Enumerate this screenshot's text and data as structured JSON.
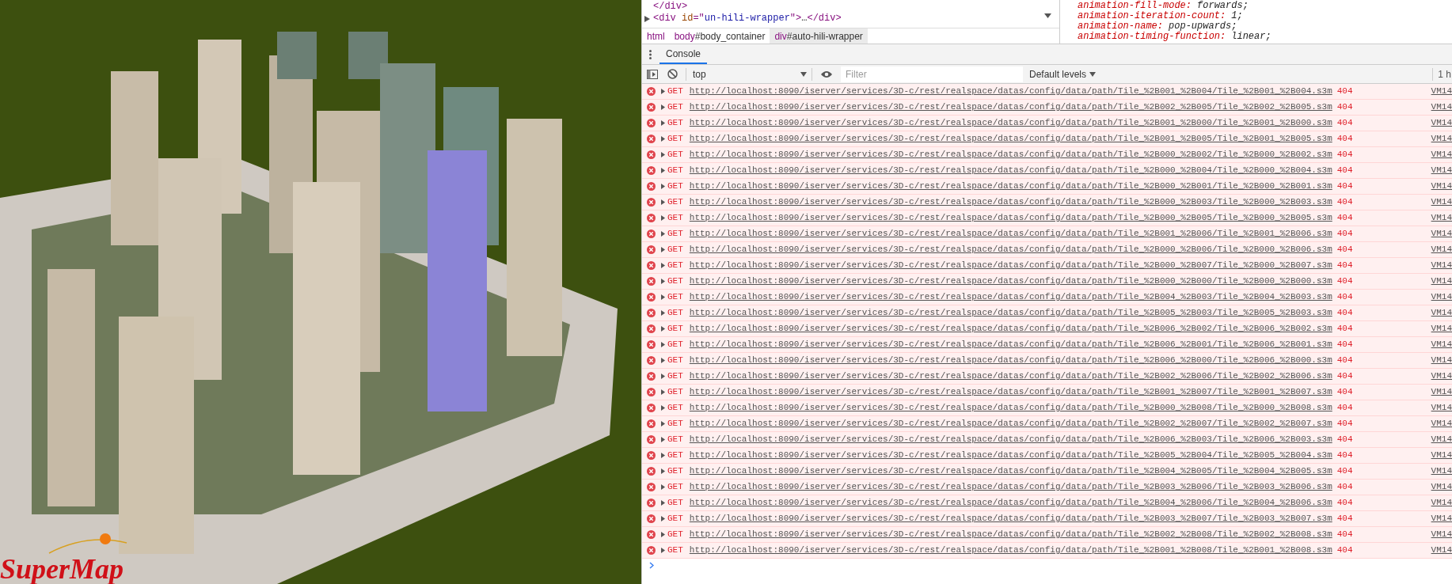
{
  "scene": {
    "logo": {
      "text": "SuperMap"
    }
  },
  "devtools": {
    "elements": {
      "lines": [
        {
          "expandable": false,
          "tokens": [
            {
              "kind": "tag",
              "text": "</div>"
            }
          ]
        },
        {
          "expandable": true,
          "tokens": [
            {
              "kind": "tag",
              "text": "<div "
            },
            {
              "kind": "attr",
              "text": "id"
            },
            {
              "kind": "tag",
              "text": "=\""
            },
            {
              "kind": "value",
              "text": "un-hili-wrapper"
            },
            {
              "kind": "tag",
              "text": "\">"
            },
            {
              "kind": "plain",
              "text": "…"
            },
            {
              "kind": "tag",
              "text": "</div>"
            }
          ]
        }
      ]
    },
    "styles": {
      "lines": [
        {
          "property": "animation-fill-mode:",
          "value": "forwards;"
        },
        {
          "property": "animation-iteration-count:",
          "value": "1;"
        },
        {
          "property": "animation-name:",
          "value": "pop-upwards;"
        },
        {
          "property": "animation-timing-function:",
          "value": "linear;"
        }
      ]
    },
    "breadcrumbs": [
      {
        "tag": "html",
        "selected": false
      },
      {
        "tag": "body",
        "id": "#body_container",
        "selected": false
      },
      {
        "tag": "div",
        "id": "#auto-hili-wrapper",
        "selected": true
      }
    ],
    "drawer_tabs": [
      {
        "label": "Console",
        "selected": true
      }
    ],
    "toolbar": {
      "context": "top",
      "filter_placeholder": "Filter",
      "levels": "Default levels",
      "time_cut": "1 h"
    },
    "messages": [
      {
        "kind": "error",
        "method": "GET",
        "url": "http://localhost:8090/iserver/services/3D-c/rest/realspace/datas/config/data/path/Tile_%2B001_%2B004/Tile_%2B001_%2B004.s3m",
        "status": "404",
        "source": "VM14"
      },
      {
        "kind": "error",
        "method": "GET",
        "url": "http://localhost:8090/iserver/services/3D-c/rest/realspace/datas/config/data/path/Tile_%2B002_%2B005/Tile_%2B002_%2B005.s3m",
        "status": "404",
        "source": "VM14"
      },
      {
        "kind": "error",
        "method": "GET",
        "url": "http://localhost:8090/iserver/services/3D-c/rest/realspace/datas/config/data/path/Tile_%2B001_%2B000/Tile_%2B001_%2B000.s3m",
        "status": "404",
        "source": "VM14"
      },
      {
        "kind": "error",
        "method": "GET",
        "url": "http://localhost:8090/iserver/services/3D-c/rest/realspace/datas/config/data/path/Tile_%2B001_%2B005/Tile_%2B001_%2B005.s3m",
        "status": "404",
        "source": "VM14"
      },
      {
        "kind": "error",
        "method": "GET",
        "url": "http://localhost:8090/iserver/services/3D-c/rest/realspace/datas/config/data/path/Tile_%2B000_%2B002/Tile_%2B000_%2B002.s3m",
        "status": "404",
        "source": "VM14"
      },
      {
        "kind": "error",
        "method": "GET",
        "url": "http://localhost:8090/iserver/services/3D-c/rest/realspace/datas/config/data/path/Tile_%2B000_%2B004/Tile_%2B000_%2B004.s3m",
        "status": "404",
        "source": "VM14"
      },
      {
        "kind": "error",
        "method": "GET",
        "url": "http://localhost:8090/iserver/services/3D-c/rest/realspace/datas/config/data/path/Tile_%2B000_%2B001/Tile_%2B000_%2B001.s3m",
        "status": "404",
        "source": "VM14"
      },
      {
        "kind": "error",
        "method": "GET",
        "url": "http://localhost:8090/iserver/services/3D-c/rest/realspace/datas/config/data/path/Tile_%2B000_%2B003/Tile_%2B000_%2B003.s3m",
        "status": "404",
        "source": "VM14"
      },
      {
        "kind": "error",
        "method": "GET",
        "url": "http://localhost:8090/iserver/services/3D-c/rest/realspace/datas/config/data/path/Tile_%2B000_%2B005/Tile_%2B000_%2B005.s3m",
        "status": "404",
        "source": "VM14"
      },
      {
        "kind": "error",
        "method": "GET",
        "url": "http://localhost:8090/iserver/services/3D-c/rest/realspace/datas/config/data/path/Tile_%2B001_%2B006/Tile_%2B001_%2B006.s3m",
        "status": "404",
        "source": "VM14"
      },
      {
        "kind": "error",
        "method": "GET",
        "url": "http://localhost:8090/iserver/services/3D-c/rest/realspace/datas/config/data/path/Tile_%2B000_%2B006/Tile_%2B000_%2B006.s3m",
        "status": "404",
        "source": "VM14"
      },
      {
        "kind": "error",
        "method": "GET",
        "url": "http://localhost:8090/iserver/services/3D-c/rest/realspace/datas/config/data/path/Tile_%2B000_%2B007/Tile_%2B000_%2B007.s3m",
        "status": "404",
        "source": "VM14"
      },
      {
        "kind": "error",
        "method": "GET",
        "url": "http://localhost:8090/iserver/services/3D-c/rest/realspace/datas/config/data/path/Tile_%2B000_%2B000/Tile_%2B000_%2B000.s3m",
        "status": "404",
        "source": "VM14"
      },
      {
        "kind": "error",
        "method": "GET",
        "url": "http://localhost:8090/iserver/services/3D-c/rest/realspace/datas/config/data/path/Tile_%2B004_%2B003/Tile_%2B004_%2B003.s3m",
        "status": "404",
        "source": "VM14"
      },
      {
        "kind": "error",
        "method": "GET",
        "url": "http://localhost:8090/iserver/services/3D-c/rest/realspace/datas/config/data/path/Tile_%2B005_%2B003/Tile_%2B005_%2B003.s3m",
        "status": "404",
        "source": "VM14"
      },
      {
        "kind": "error",
        "method": "GET",
        "url": "http://localhost:8090/iserver/services/3D-c/rest/realspace/datas/config/data/path/Tile_%2B006_%2B002/Tile_%2B006_%2B002.s3m",
        "status": "404",
        "source": "VM14"
      },
      {
        "kind": "error",
        "method": "GET",
        "url": "http://localhost:8090/iserver/services/3D-c/rest/realspace/datas/config/data/path/Tile_%2B006_%2B001/Tile_%2B006_%2B001.s3m",
        "status": "404",
        "source": "VM14"
      },
      {
        "kind": "error",
        "method": "GET",
        "url": "http://localhost:8090/iserver/services/3D-c/rest/realspace/datas/config/data/path/Tile_%2B006_%2B000/Tile_%2B006_%2B000.s3m",
        "status": "404",
        "source": "VM14"
      },
      {
        "kind": "error",
        "method": "GET",
        "url": "http://localhost:8090/iserver/services/3D-c/rest/realspace/datas/config/data/path/Tile_%2B002_%2B006/Tile_%2B002_%2B006.s3m",
        "status": "404",
        "source": "VM14"
      },
      {
        "kind": "error",
        "method": "GET",
        "url": "http://localhost:8090/iserver/services/3D-c/rest/realspace/datas/config/data/path/Tile_%2B001_%2B007/Tile_%2B001_%2B007.s3m",
        "status": "404",
        "source": "VM14"
      },
      {
        "kind": "error",
        "method": "GET",
        "url": "http://localhost:8090/iserver/services/3D-c/rest/realspace/datas/config/data/path/Tile_%2B000_%2B008/Tile_%2B000_%2B008.s3m",
        "status": "404",
        "source": "VM14"
      },
      {
        "kind": "error",
        "method": "GET",
        "url": "http://localhost:8090/iserver/services/3D-c/rest/realspace/datas/config/data/path/Tile_%2B002_%2B007/Tile_%2B002_%2B007.s3m",
        "status": "404",
        "source": "VM14"
      },
      {
        "kind": "error",
        "method": "GET",
        "url": "http://localhost:8090/iserver/services/3D-c/rest/realspace/datas/config/data/path/Tile_%2B006_%2B003/Tile_%2B006_%2B003.s3m",
        "status": "404",
        "source": "VM14"
      },
      {
        "kind": "error",
        "method": "GET",
        "url": "http://localhost:8090/iserver/services/3D-c/rest/realspace/datas/config/data/path/Tile_%2B005_%2B004/Tile_%2B005_%2B004.s3m",
        "status": "404",
        "source": "VM14"
      },
      {
        "kind": "error",
        "method": "GET",
        "url": "http://localhost:8090/iserver/services/3D-c/rest/realspace/datas/config/data/path/Tile_%2B004_%2B005/Tile_%2B004_%2B005.s3m",
        "status": "404",
        "source": "VM14"
      },
      {
        "kind": "error",
        "method": "GET",
        "url": "http://localhost:8090/iserver/services/3D-c/rest/realspace/datas/config/data/path/Tile_%2B003_%2B006/Tile_%2B003_%2B006.s3m",
        "status": "404",
        "source": "VM14"
      },
      {
        "kind": "error",
        "method": "GET",
        "url": "http://localhost:8090/iserver/services/3D-c/rest/realspace/datas/config/data/path/Tile_%2B004_%2B006/Tile_%2B004_%2B006.s3m",
        "status": "404",
        "source": "VM14"
      },
      {
        "kind": "error",
        "method": "GET",
        "url": "http://localhost:8090/iserver/services/3D-c/rest/realspace/datas/config/data/path/Tile_%2B003_%2B007/Tile_%2B003_%2B007.s3m",
        "status": "404",
        "source": "VM14"
      },
      {
        "kind": "error",
        "method": "GET",
        "url": "http://localhost:8090/iserver/services/3D-c/rest/realspace/datas/config/data/path/Tile_%2B002_%2B008/Tile_%2B002_%2B008.s3m",
        "status": "404",
        "source": "VM14"
      },
      {
        "kind": "error",
        "method": "GET",
        "url": "http://localhost:8090/iserver/services/3D-c/rest/realspace/datas/config/data/path/Tile_%2B001_%2B008/Tile_%2B001_%2B008.s3m",
        "status": "404",
        "source": "VM14"
      }
    ]
  }
}
